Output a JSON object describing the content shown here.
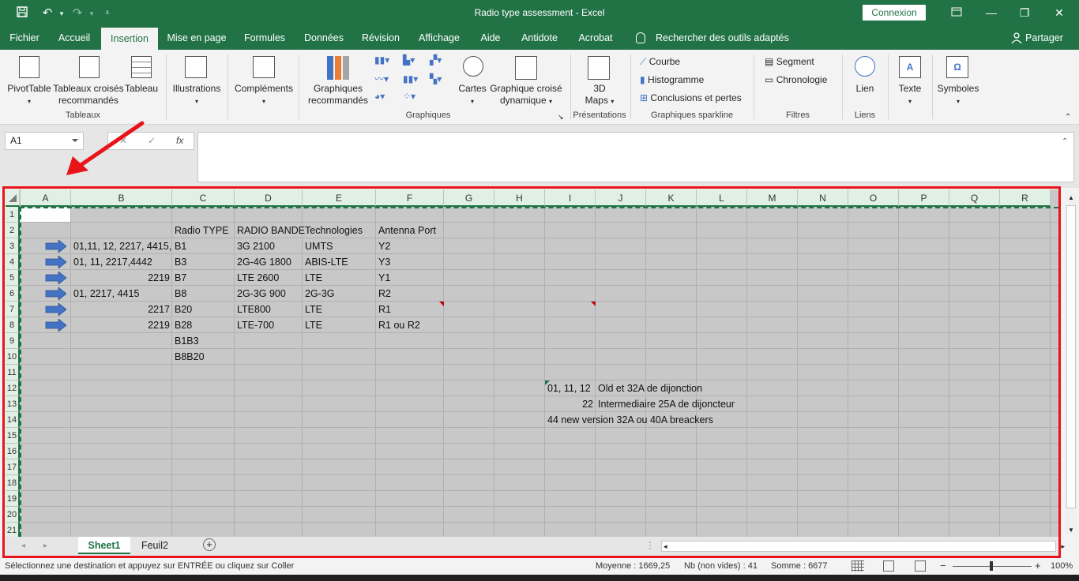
{
  "window": {
    "title": "Radio type assessment  -  Excel",
    "connexion": "Connexion"
  },
  "tabs": [
    {
      "label": "Fichier"
    },
    {
      "label": "Accueil"
    },
    {
      "label": "Insertion"
    },
    {
      "label": "Mise en page"
    },
    {
      "label": "Formules"
    },
    {
      "label": "Données"
    },
    {
      "label": "Révision"
    },
    {
      "label": "Affichage"
    },
    {
      "label": "Aide"
    },
    {
      "label": "Antidote"
    },
    {
      "label": "Acrobat"
    }
  ],
  "search": {
    "label": "Rechercher des outils adaptés"
  },
  "share": {
    "label": "Partager"
  },
  "ribbon": {
    "pivottable": "PivotTable",
    "recommended_pivot": [
      "Tableaux croisés",
      "recommandés"
    ],
    "table": "Tableau",
    "illustrations": "Illustrations",
    "addins": "Compléments",
    "recommended_charts": [
      "Graphiques",
      "recommandés"
    ],
    "maps": "Cartes",
    "pivotchart": [
      "Graphique croisé",
      "dynamique"
    ],
    "map3d": [
      "3D",
      "Maps"
    ],
    "sparkline_line": "Courbe",
    "sparkline_column": "Histogramme",
    "sparkline_winloss": "Conclusions et pertes",
    "slicer": "Segment",
    "timeline": "Chronologie",
    "link": "Lien",
    "text": "Texte",
    "symbols": "Symboles",
    "groups": {
      "tableaux": "Tableaux",
      "graphiques": "Graphiques",
      "presentations": "Présentations",
      "sparkline": "Graphiques sparkline",
      "filtres": "Filtres",
      "liens": "Liens"
    }
  },
  "formula_bar": {
    "name_box": "A1",
    "fx": "fx",
    "formula": ""
  },
  "columns": [
    "A",
    "B",
    "C",
    "D",
    "E",
    "F",
    "G",
    "H",
    "I",
    "J",
    "K",
    "L",
    "M",
    "N",
    "O",
    "P",
    "Q",
    "R"
  ],
  "rows": [
    "1",
    "2",
    "3",
    "4",
    "5",
    "6",
    "7",
    "8",
    "9",
    "10",
    "11",
    "12",
    "13",
    "14",
    "15",
    "16",
    "17",
    "18",
    "19",
    "20",
    "21"
  ],
  "cells": {
    "C2": "Radio TYPE",
    "D2": "RADIO BANDE",
    "E2": "Technologies",
    "F2": "Antenna Port",
    "B3": "01,11, 12, 2217, 4415,",
    "C3": "B1",
    "D3": "3G 2100",
    "E3": "UMTS",
    "F3": "Y2",
    "B4": "01, 11, 2217,4442",
    "C4": "B3",
    "D4": "2G-4G 1800",
    "E4": "ABIS-LTE",
    "F4": "Y3",
    "B5": "2219",
    "C5": "B7",
    "D5": "LTE 2600",
    "E5": "LTE",
    "F5": "Y1",
    "B6": "01, 2217, 4415",
    "C6": "B8",
    "D6": "2G-3G 900",
    "E6": "2G-3G",
    "F6": "R2",
    "B7": "2217",
    "C7": "B20",
    "D7": "LTE800",
    "E7": "LTE",
    "F7": "R1",
    "B8": "2219",
    "C8": "B28",
    "D8": "LTE-700",
    "E8": "LTE",
    "F8": "R1 ou R2",
    "C9": "B1B3",
    "C10": "B8B20",
    "I12": "01, 11, 12",
    "J12": "Old et 32A de dijonction",
    "I13": "22",
    "J13": "Intermediaire 25A de dijoncteur",
    "I14": "44 new version 32A ou 40A breackers"
  },
  "sheets": [
    {
      "label": "Sheet1"
    },
    {
      "label": "Feuil2"
    }
  ],
  "status": {
    "message": "Sélectionnez une destination et appuyez sur ENTRÉE ou cliquez sur Coller",
    "average": "Moyenne : 1669,25",
    "count": "Nb (non vides) : 41",
    "sum": "Somme : 6677",
    "zoom": "100%"
  },
  "colors": {
    "accent": "#217346",
    "annotation": "#e8141b",
    "arrow": "#4472c4"
  }
}
